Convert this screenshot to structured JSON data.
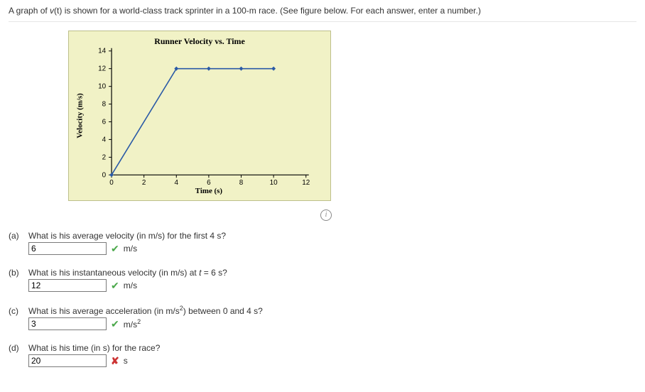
{
  "intro": {
    "pre": "A graph of ",
    "var": "v",
    "arg": "(t)",
    "post": " is shown for a world-class track sprinter in a 100-m race. (See figure below. For each answer, enter a number.)"
  },
  "chart_data": {
    "type": "line",
    "title": "Runner Velocity vs. Time",
    "xlabel": "Time (s)",
    "ylabel": "Velocity (m/s)",
    "xlim": [
      0,
      12
    ],
    "ylim": [
      0,
      14
    ],
    "xticks": [
      0,
      2,
      4,
      6,
      8,
      10,
      12
    ],
    "yticks": [
      0,
      2,
      4,
      6,
      8,
      10,
      12,
      14
    ],
    "series": [
      {
        "name": "velocity",
        "x": [
          0,
          4,
          6,
          8,
          10
        ],
        "values": [
          0,
          12,
          12,
          12,
          12
        ]
      }
    ]
  },
  "info_icon": "i",
  "questions": {
    "a": {
      "letter": "(a)",
      "text": "What is his average velocity (in m/s) for the first 4 s?",
      "answer": "6",
      "unit": "m/s",
      "correct": true
    },
    "b": {
      "letter": "(b)",
      "text_pre": "What is his instantaneous velocity (in m/s) at ",
      "text_var": "t",
      "text_post": " = 6 s?",
      "answer": "12",
      "unit": "m/s",
      "correct": true
    },
    "c": {
      "letter": "(c)",
      "text_pre": "What is his average acceleration (in m/s",
      "text_sup": "2",
      "text_post": ") between 0 and 4 s?",
      "answer": "3",
      "unit_pre": "m/s",
      "unit_sup": "2",
      "correct": true
    },
    "d": {
      "letter": "(d)",
      "text": "What is his time (in s) for the race?",
      "answer": "20",
      "unit": "s",
      "correct": false
    }
  },
  "marks": {
    "check": "✔",
    "cross": "✘"
  }
}
